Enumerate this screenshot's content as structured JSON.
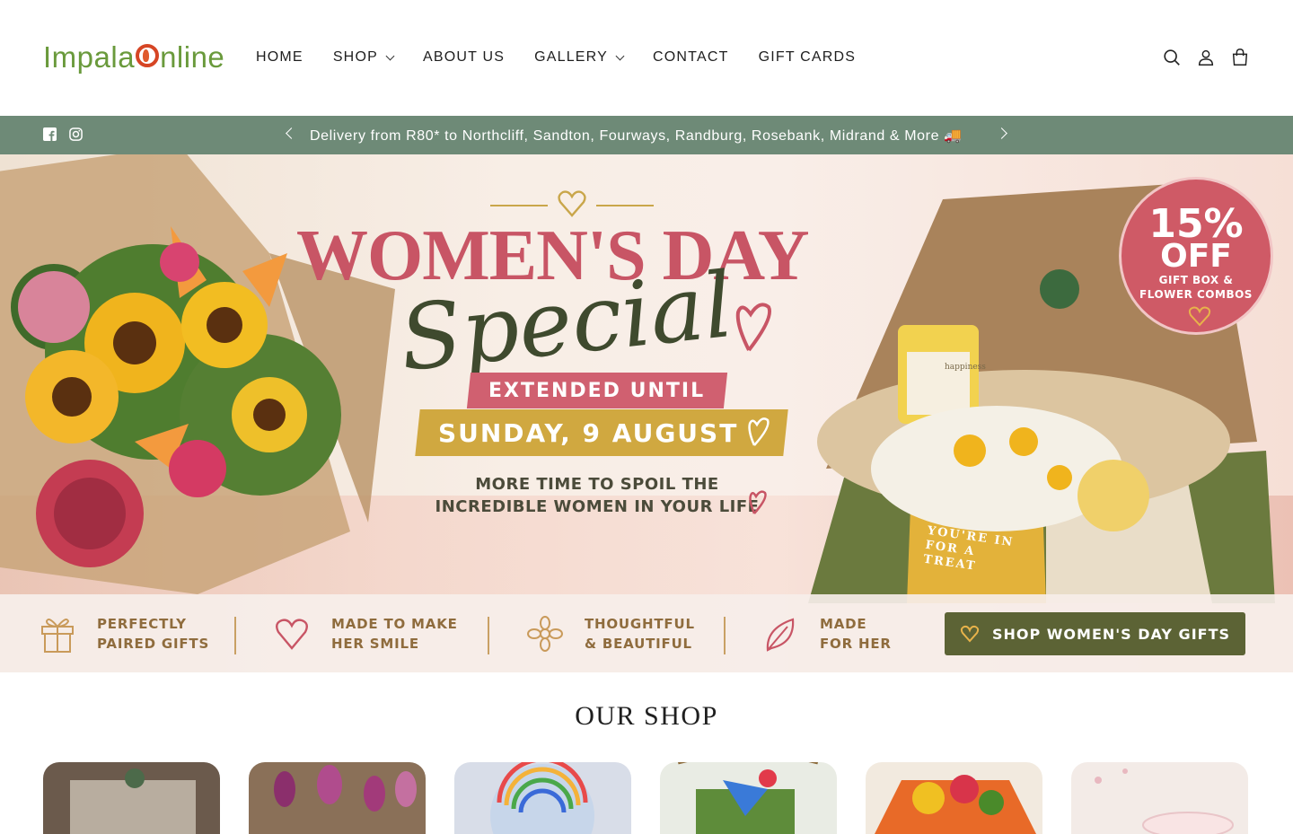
{
  "logo": {
    "text_left": "Impala",
    "text_right": "nline"
  },
  "nav": {
    "items": [
      {
        "label": "HOME",
        "has_dropdown": false
      },
      {
        "label": "SHOP",
        "has_dropdown": true
      },
      {
        "label": "ABOUT US",
        "has_dropdown": false
      },
      {
        "label": "GALLERY",
        "has_dropdown": true
      },
      {
        "label": "CONTACT",
        "has_dropdown": false
      },
      {
        "label": "GIFT CARDS",
        "has_dropdown": false
      }
    ]
  },
  "header_icons": [
    "search-icon",
    "account-icon",
    "cart-icon"
  ],
  "announcement": {
    "text": "Delivery from R80* to Northcliff, Sandton, Fourways, Randburg, Rosebank, Midrand & More 🚚",
    "social": [
      "facebook-icon",
      "instagram-icon"
    ],
    "background": "#6e8a77"
  },
  "hero": {
    "title": "WOMEN'S DAY",
    "script": "Special",
    "banner_red": "EXTENDED UNTIL",
    "banner_gold": "SUNDAY, 9 AUGUST",
    "subtext_line1": "MORE TIME TO SPOIL THE",
    "subtext_line2": "INCREDIBLE WOMEN IN YOUR LIFE",
    "badge": {
      "line1": "15%",
      "line2": "OFF",
      "line3": "GIFT BOX &",
      "line4": "FLOWER COMBOS"
    },
    "box_text_line1": "YOU'RE IN",
    "box_text_line2": "FOR A TREAT",
    "tea_label": "happiness",
    "colors": {
      "pink": "#c85565",
      "gold": "#d0a840",
      "olive": "#5c6335"
    }
  },
  "features": [
    {
      "icon": "gift-icon",
      "line1": "PERFECTLY",
      "line2": "PAIRED GIFTS"
    },
    {
      "icon": "heart-icon",
      "line1": "MADE TO MAKE",
      "line2": "HER SMILE"
    },
    {
      "icon": "flower-icon",
      "line1": "THOUGHTFUL",
      "line2": "& BEAUTIFUL"
    },
    {
      "icon": "leaf-icon",
      "line1": "MADE",
      "line2": "FOR HER"
    }
  ],
  "cta": {
    "label": "SHOP WOMEN'S DAY GIFTS",
    "icon": "heart-icon"
  },
  "shop": {
    "title": "OUR SHOP",
    "cards": [
      {
        "name": "gift-box",
        "bg": "#6b5a4c"
      },
      {
        "name": "tulips",
        "bg": "#8a5a70"
      },
      {
        "name": "balloon",
        "bg": "#b8cde0"
      },
      {
        "name": "basket",
        "bg": "#7c9c5a"
      },
      {
        "name": "bouquet",
        "bg": "#d56a2d"
      },
      {
        "name": "candle",
        "bg": "#efe3dd"
      }
    ]
  }
}
